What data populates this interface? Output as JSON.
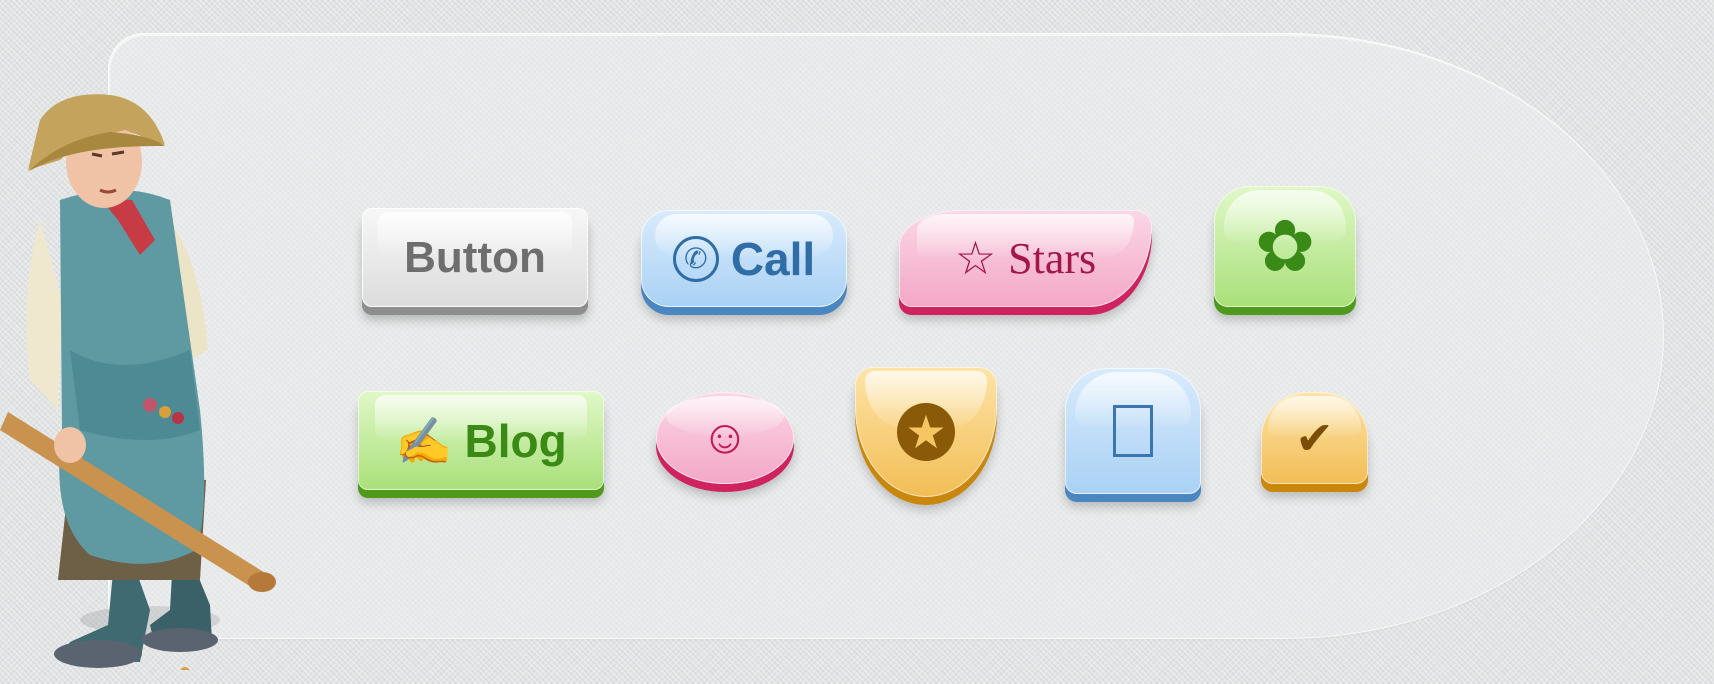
{
  "buttons": {
    "button": {
      "label": "Button"
    },
    "call": {
      "label": "Call",
      "icon": "phone-icon",
      "glyph": "✆"
    },
    "stars": {
      "label": "Stars",
      "icon": "star-icon",
      "glyph": "☆"
    },
    "flower": {
      "icon": "flower-icon",
      "glyph": "✿"
    },
    "blog": {
      "label": "Blog",
      "icon": "pen-icon",
      "glyph": "✍"
    },
    "smile": {
      "icon": "smiley-icon",
      "glyph": "☺"
    },
    "badge": {
      "icon": "star-badge-icon",
      "glyph": "★"
    },
    "square": {
      "icon": "empty-box-icon"
    },
    "check": {
      "icon": "checkmark-icon",
      "glyph": "✔"
    }
  },
  "colors": {
    "gray": "#dcdcdc",
    "blue": "#a9d1f5",
    "pink": "#f3a7c6",
    "green": "#a9e07a",
    "orange": "#f2bd55"
  }
}
